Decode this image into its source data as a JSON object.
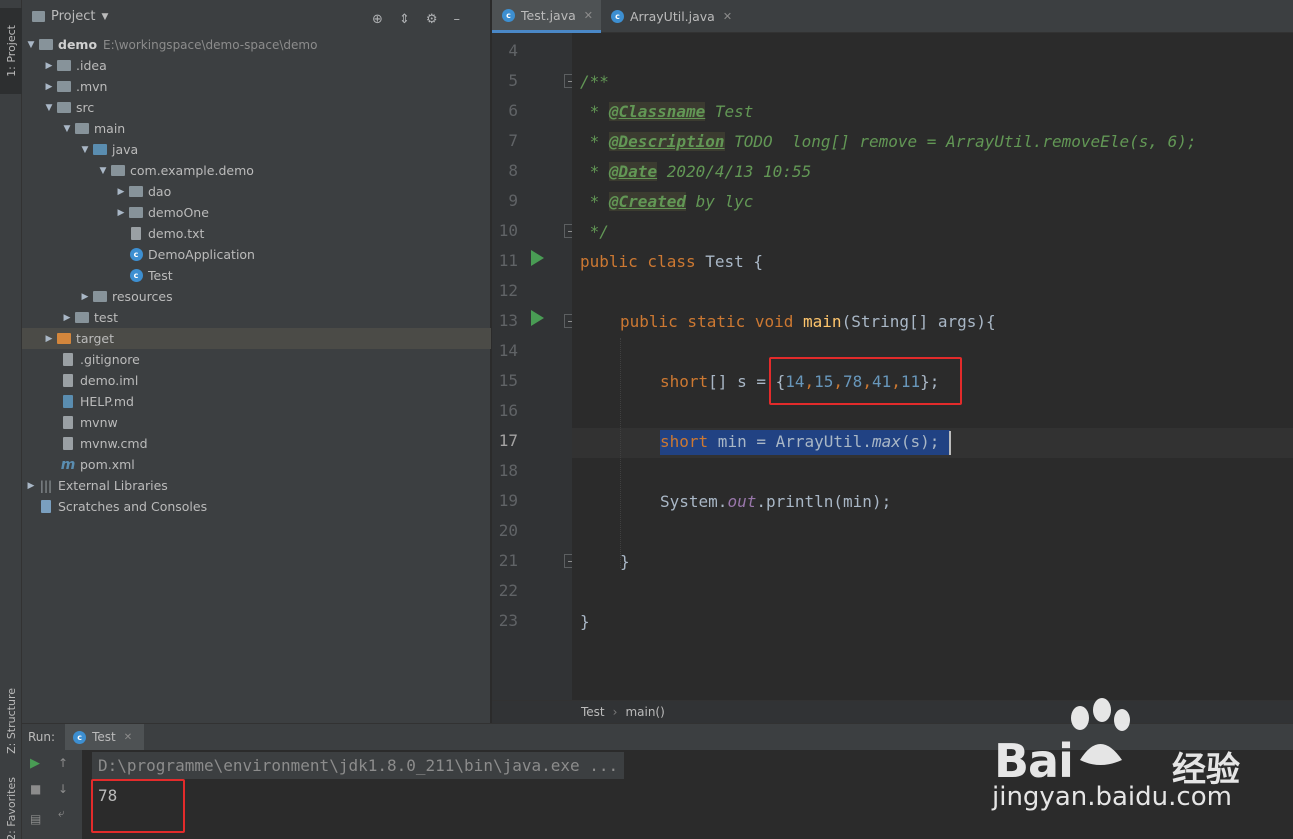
{
  "tool_strip": {
    "project_tab": "1: Project",
    "structure_tab": "Z: Structure",
    "favorites_tab": "2: Favorites"
  },
  "project": {
    "header_title": "Project",
    "tree": [
      {
        "label": "demo",
        "sub": "E:\\workingspace\\demo-space\\demo"
      },
      {
        "label": ".idea"
      },
      {
        "label": ".mvn"
      },
      {
        "label": "src"
      },
      {
        "label": "main"
      },
      {
        "label": "java"
      },
      {
        "label": "com.example.demo"
      },
      {
        "label": "dao"
      },
      {
        "label": "demoOne"
      },
      {
        "label": "demo.txt"
      },
      {
        "label": "DemoApplication"
      },
      {
        "label": "Test"
      },
      {
        "label": "resources"
      },
      {
        "label": "test"
      },
      {
        "label": "target"
      },
      {
        "label": ".gitignore"
      },
      {
        "label": "demo.iml"
      },
      {
        "label": "HELP.md"
      },
      {
        "label": "mvnw"
      },
      {
        "label": "mvnw.cmd"
      },
      {
        "label": "pom.xml"
      },
      {
        "label": "External Libraries"
      },
      {
        "label": "Scratches and Consoles"
      }
    ]
  },
  "editor": {
    "tabs": [
      {
        "label": "Test.java"
      },
      {
        "label": "ArrayUtil.java"
      }
    ],
    "line_numbers": [
      "4",
      "5",
      "6",
      "7",
      "8",
      "9",
      "10",
      "11",
      "12",
      "13",
      "14",
      "15",
      "16",
      "17",
      "18",
      "19",
      "20",
      "21",
      "22",
      "23"
    ],
    "code": {
      "l5": "/**",
      "l6_tag": "@Classname",
      "l6_rest": " Test",
      "l7_tag": "@Description",
      "l7_rest": " TODO  long[] remove = ArrayUtil.removeEle(s, 6);",
      "l8_tag": "@Date",
      "l8_rest": " 2020/4/13 10:55",
      "l9_tag": "@Created",
      "l9_rest": " by lyc",
      "l10": " */",
      "l11_kw": "public class",
      "l11_rest": " Test {",
      "l13_kw": "public static void",
      "l13_fn": "main",
      "l13_rest": "(String[] args){",
      "l15_kw": "short",
      "l15_mid": "[] s = {",
      "l15_nums": [
        "14",
        "15",
        "78",
        "41",
        "11"
      ],
      "l15_end": "};",
      "l17_kw": "short",
      "l17_mid": " min = ArrayUtil.",
      "l17_fn": "max",
      "l17_end": "(s);",
      "l19_a": "System.",
      "l19_static": "out",
      "l19_b": ".println(min);",
      "l21": "}",
      "l23": "}"
    },
    "breadcrumb": [
      "Test",
      "main()"
    ]
  },
  "run": {
    "label": "Run:",
    "tab": "Test",
    "command": "D:\\programme\\environment\\jdk1.8.0_211\\bin\\java.exe ...",
    "output": "78"
  },
  "watermark": {
    "brand": "Bai",
    "brand_cn": "经验",
    "url": "jingyan.baidu.com"
  },
  "colors": {
    "background": "#2b2b2b",
    "keyword": "#cc7832",
    "number": "#6897bb",
    "doc": "#629755",
    "highlight_box": "#e32b2b",
    "selection": "#214283"
  }
}
